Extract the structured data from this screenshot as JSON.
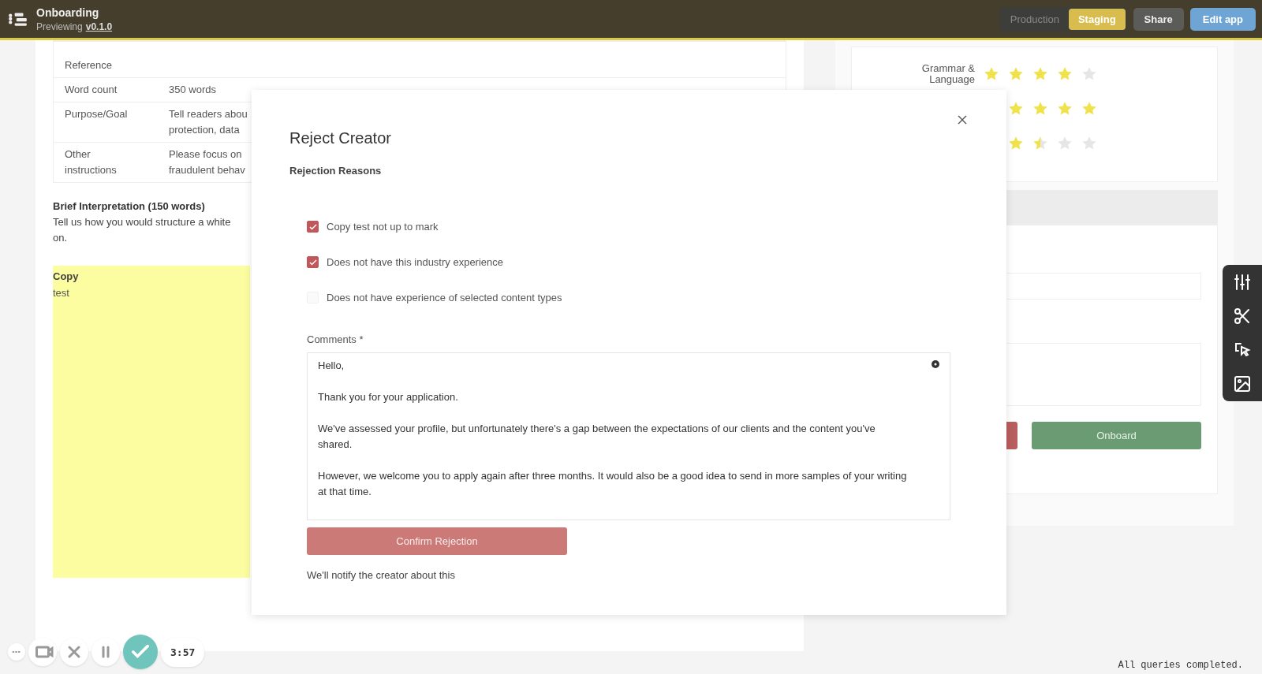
{
  "header": {
    "title": "Onboarding",
    "subtitle": "Previewing",
    "version": "v0.1.0",
    "environments": [
      {
        "label": "Production",
        "selected": false
      },
      {
        "label": "Staging",
        "selected": true
      }
    ],
    "share": "Share",
    "edit": "Edit app"
  },
  "brief": {
    "rows": [
      {
        "label": "Reference",
        "value": ""
      },
      {
        "label": "Word count",
        "value": "350 words"
      },
      {
        "label": "Purpose/Goal",
        "value": "Tell readers abou\nprotection, data"
      },
      {
        "label": "Other\ninstructions",
        "value": "Please focus on\nfraudulent behav"
      }
    ],
    "interpretation_title": "Brief Interpretation (150 words)",
    "interpretation_text": "Tell us how you would structure a white\non.",
    "copy_label": "Copy",
    "copy_text": "test"
  },
  "ratings": [
    {
      "kind": "full",
      "label": "Grammar &\nLanguage",
      "stars": 4
    },
    {
      "kind": "partial",
      "stars": 4
    },
    {
      "kind": "partial",
      "stars": 1.5
    }
  ],
  "actions": {
    "onboard": "Onboard"
  },
  "modal": {
    "title": "Reject Creator",
    "section": "Rejection Reasons",
    "reasons": [
      {
        "label": "Copy test not up to mark",
        "checked": true
      },
      {
        "label": "Does not have this industry experience",
        "checked": true
      },
      {
        "label": "Does not have experience of selected content types",
        "checked": false
      }
    ],
    "comments_label": "Comments *",
    "comments": [
      "Hello,",
      "Thank you for your application.",
      "We've assessed your profile, but unfortunately there's a gap between the expectations of our clients and the content you've shared.",
      "However, we welcome you to apply again after three months. It would also be a good idea to send in more samples of your writing at that time."
    ],
    "confirm": "Confirm Rejection",
    "note": "We'll notify the creator about this"
  },
  "recorder": {
    "time": "3:57"
  },
  "status": "All queries completed."
}
